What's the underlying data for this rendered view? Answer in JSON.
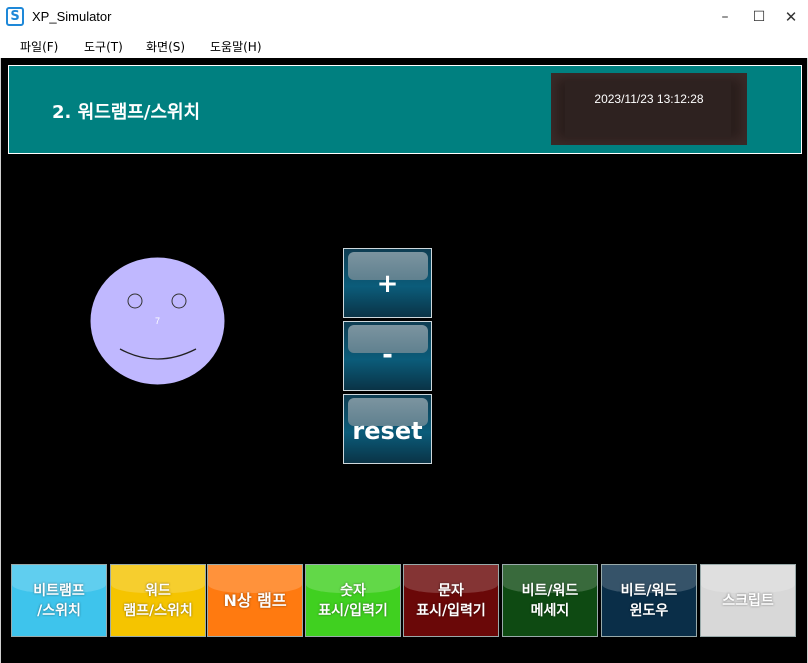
{
  "window": {
    "title": "XP_Simulator",
    "icon_letter": "S",
    "controls": {
      "minimize": "–",
      "maximize": "☐",
      "close": "✕"
    }
  },
  "menu": [
    {
      "label": "파일(F)"
    },
    {
      "label": "도구(T)"
    },
    {
      "label": "화면(S)"
    },
    {
      "label": "도움말(H)"
    }
  ],
  "header": {
    "title": "2. 워드램프/스위치",
    "datetime": "2023/11/23 13:12:28"
  },
  "lamp": {
    "value_label": "7",
    "color": "#c0b8ff"
  },
  "controls": {
    "plus": "+",
    "minus": "-",
    "reset": "reset"
  },
  "nav": [
    {
      "line1": "비트램프",
      "line2": "/스위치",
      "color": "#3ec4ec"
    },
    {
      "line1": "워드",
      "line2": "램프/스위치",
      "color": "#f5c400"
    },
    {
      "line1": "N상 램프",
      "line2": "",
      "color": "#ff7a10"
    },
    {
      "line1": "숫자",
      "line2": "표시/입력기",
      "color": "#40d020"
    },
    {
      "line1": "문자",
      "line2": "표시/입력기",
      "color": "#6a0808"
    },
    {
      "line1": "비트/워드",
      "line2": "메세지",
      "color": "#0e4a12"
    },
    {
      "line1": "비트/워드",
      "line2": "윈도우",
      "color": "#0a2e48"
    },
    {
      "line1": "스크립트",
      "line2": "",
      "color": "#d8d8d8"
    }
  ]
}
